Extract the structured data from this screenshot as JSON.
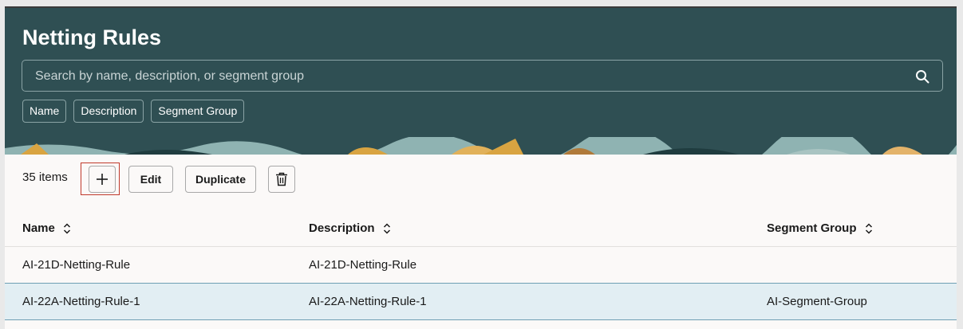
{
  "header": {
    "title": "Netting Rules",
    "search_placeholder": "Search by name, description, or segment group",
    "filter_chips": [
      "Name",
      "Description",
      "Segment Group"
    ]
  },
  "toolbar": {
    "item_count": "35 items",
    "add_icon": "plus-icon",
    "edit_label": "Edit",
    "duplicate_label": "Duplicate",
    "delete_icon": "trash-icon"
  },
  "table": {
    "columns": [
      "Name",
      "Description",
      "Segment Group"
    ],
    "rows": [
      {
        "name": "AI-21D-Netting-Rule",
        "description": "AI-21D-Netting-Rule",
        "segment_group": ""
      },
      {
        "name": "AI-22A-Netting-Rule-1",
        "description": "AI-22A-Netting-Rule-1",
        "segment_group": "AI-Segment-Group"
      }
    ]
  },
  "colors": {
    "header_bg": "#2f4f53",
    "page_bg": "#fbf9f8",
    "selected_row_bg": "#e2eef3",
    "highlight_border": "#c0392b"
  }
}
